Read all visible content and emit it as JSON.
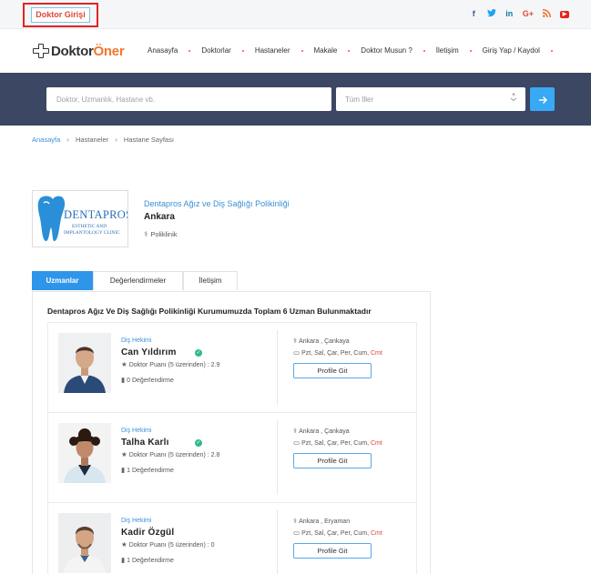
{
  "topbar": {
    "doctor_login": "Doktor Girişi",
    "socials": [
      {
        "name": "facebook-icon",
        "glyph": "f"
      },
      {
        "name": "twitter-icon",
        "glyph": "✓"
      },
      {
        "name": "linkedin-icon",
        "glyph": "in"
      },
      {
        "name": "google-plus-icon",
        "glyph": "G+"
      },
      {
        "name": "rss-icon",
        "glyph": "≋"
      },
      {
        "name": "youtube-icon",
        "glyph": "▶"
      }
    ]
  },
  "logo": {
    "part1": "Doktor",
    "part2": "Öner"
  },
  "nav": {
    "items": [
      "Anasayfa",
      "Doktorlar",
      "Hastaneler",
      "Makale",
      "Doktor Musun ?",
      "İletişim",
      "Giriş Yap / Kaydol"
    ]
  },
  "search": {
    "placeholder": "Doktor, Uzmanlık, Hastane vb.",
    "city_value": "Tüm İller",
    "button_icon": "arrow-right-icon"
  },
  "breadcrumb": {
    "home": "Anasayfa",
    "level2": "Hastaneler",
    "level3": "Hastane Sayfası"
  },
  "clinic": {
    "logo_text1": "DENTAPROS",
    "logo_text2": "ESTHETIC AND",
    "logo_text3": "IMPLANTOLOGY CLINIC",
    "name": "Dentapros Ağız ve Diş Sağlığı Polikinliği",
    "city": "Ankara",
    "type": "Poliklinik"
  },
  "tabs": [
    "Uzmanlar",
    "Değerlendirmeler",
    "İletişim"
  ],
  "panel": {
    "title": "Dentapros Ağız Ve Diş Sağlığı Polikinliği Kurumumuzda Toplam 6 Uzman Bulunmaktadır"
  },
  "doctors": [
    {
      "specialty": "Diş Hekimi",
      "name": "Can Yıldırım",
      "score": "Doktor Puanı (5 üzerinden) : 2.9",
      "reviews": "0 Değerlendirme",
      "location": "Ankara , Çankaya",
      "days": "Pzt, Sal, Çar, Per, Cum,",
      "sat": "Cmt",
      "button": "Profile Git",
      "verified": true
    },
    {
      "specialty": "Diş Hekimi",
      "name": "Talha Karlı",
      "score": "Doktor Puanı (5 üzerinden) : 2.8",
      "reviews": "1 Değerlendirme",
      "location": "Ankara , Çankaya",
      "days": "Pzt, Sal, Çar, Per, Cum,",
      "sat": "Cmt",
      "button": "Profile Git",
      "verified": true
    },
    {
      "specialty": "Diş Hekimi",
      "name": "Kadir Özgül",
      "score": "Doktor Puanı (5 üzerinden) : 0",
      "reviews": "1 Değerlendirme",
      "location": "Ankara , Eryaman",
      "days": "Pzt, Sal, Çar, Per, Cum,",
      "sat": "Cmt",
      "button": "Profile Git",
      "verified": false
    }
  ],
  "colors": {
    "accent_blue": "#2e95ea",
    "search_band": "#3b4763",
    "logo_orange": "#f0772f",
    "saturday_red": "#e0463a",
    "verified_green": "#2fbb86"
  }
}
